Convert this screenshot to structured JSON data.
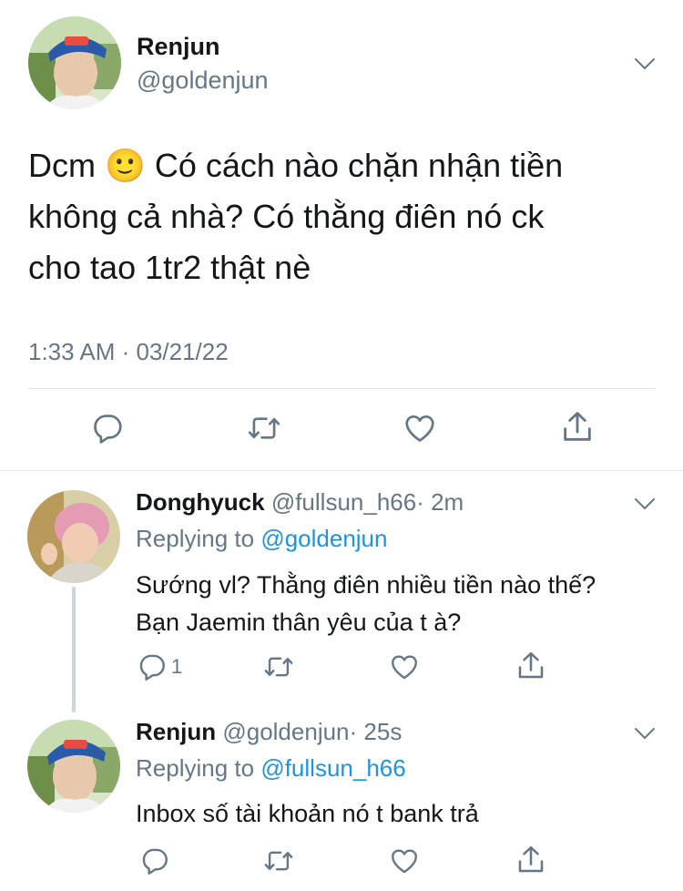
{
  "main_tweet": {
    "name": "Renjun",
    "handle": "@goldenjun",
    "text_line1_a": "Dcm",
    "emoji": "🙂",
    "text_line1_b": "Có cách nào chặn nhận tiền",
    "text_line2": "không cả nhà? Có thằng điên nó ck",
    "text_line3": "cho tao 1tr2 thật nè",
    "timestamp": "1:33 AM · 03/21/22"
  },
  "reply1": {
    "name": "Donghyuck",
    "handle": "@fullsun_h66",
    "time": "· 2m",
    "replying_label": "Replying to",
    "replying_to": "@goldenjun",
    "line1": "Sướng vl? Thằng điên nhiều tiền nào thế?",
    "line2": "Bạn Jaemin thân yêu của t à?",
    "reply_count": "1"
  },
  "reply2": {
    "name": "Renjun",
    "handle": "@goldenjun",
    "time": "· 25s",
    "replying_label": "Replying to",
    "replying_to": "@fullsun_h66",
    "line1": "Inbox số tài khoản nó t bank trả"
  },
  "icons": [
    "reply-icon",
    "retweet-icon",
    "like-icon",
    "share-icon",
    "chevron-down-icon"
  ],
  "colors": {
    "text": "#14171a",
    "secondary": "#657786",
    "link": "#1b95e0",
    "divider": "#e1e8ed",
    "thread_line": "#ccd6dd"
  }
}
